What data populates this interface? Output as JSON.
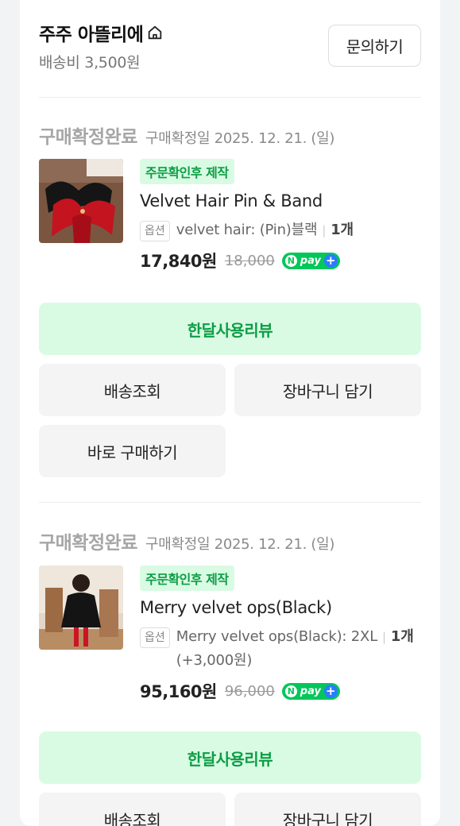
{
  "store": {
    "name": "주주 아뜰리에",
    "icon": "home-icon",
    "shipping_fee": "배송비 3,500원",
    "inquiry_label": "문의하기"
  },
  "orders": [
    {
      "status": "구매확정완료",
      "confirm_date": "구매확정일 2025. 12. 21. (일)",
      "badge": "주문확인후 제작",
      "product_name": "Velvet Hair Pin & Band",
      "option_tag": "옵션",
      "option_text": "velvet hair: (Pin)블랙",
      "quantity": "1개",
      "price": "17,840원",
      "original_price": "18,000",
      "buttons": {
        "review": "한달사용리뷰",
        "tracking": "배송조회",
        "cart": "장바구니 담기",
        "buy_now": "바로 구매하기"
      }
    },
    {
      "status": "구매확정완료",
      "confirm_date": "구매확정일 2025. 12. 21. (일)",
      "badge": "주문확인후 제작",
      "product_name": "Merry velvet ops(Black)",
      "option_tag": "옵션",
      "option_text": "Merry velvet ops(Black): 2XL",
      "quantity": "1개",
      "option_extra": "(+3,000원)",
      "price": "95,160원",
      "original_price": "96,000",
      "buttons": {
        "review": "한달사용리뷰",
        "tracking": "배송조회",
        "cart": "장바구니 담기"
      }
    }
  ],
  "npay": {
    "n": "N",
    "text": "pay",
    "plus": "+"
  },
  "colors": {
    "accent_green": "#0c9e45",
    "badge_bg": "#d9fbe3",
    "npay_green": "#03c75a",
    "npay_plus_blue": "#2b7cff"
  }
}
